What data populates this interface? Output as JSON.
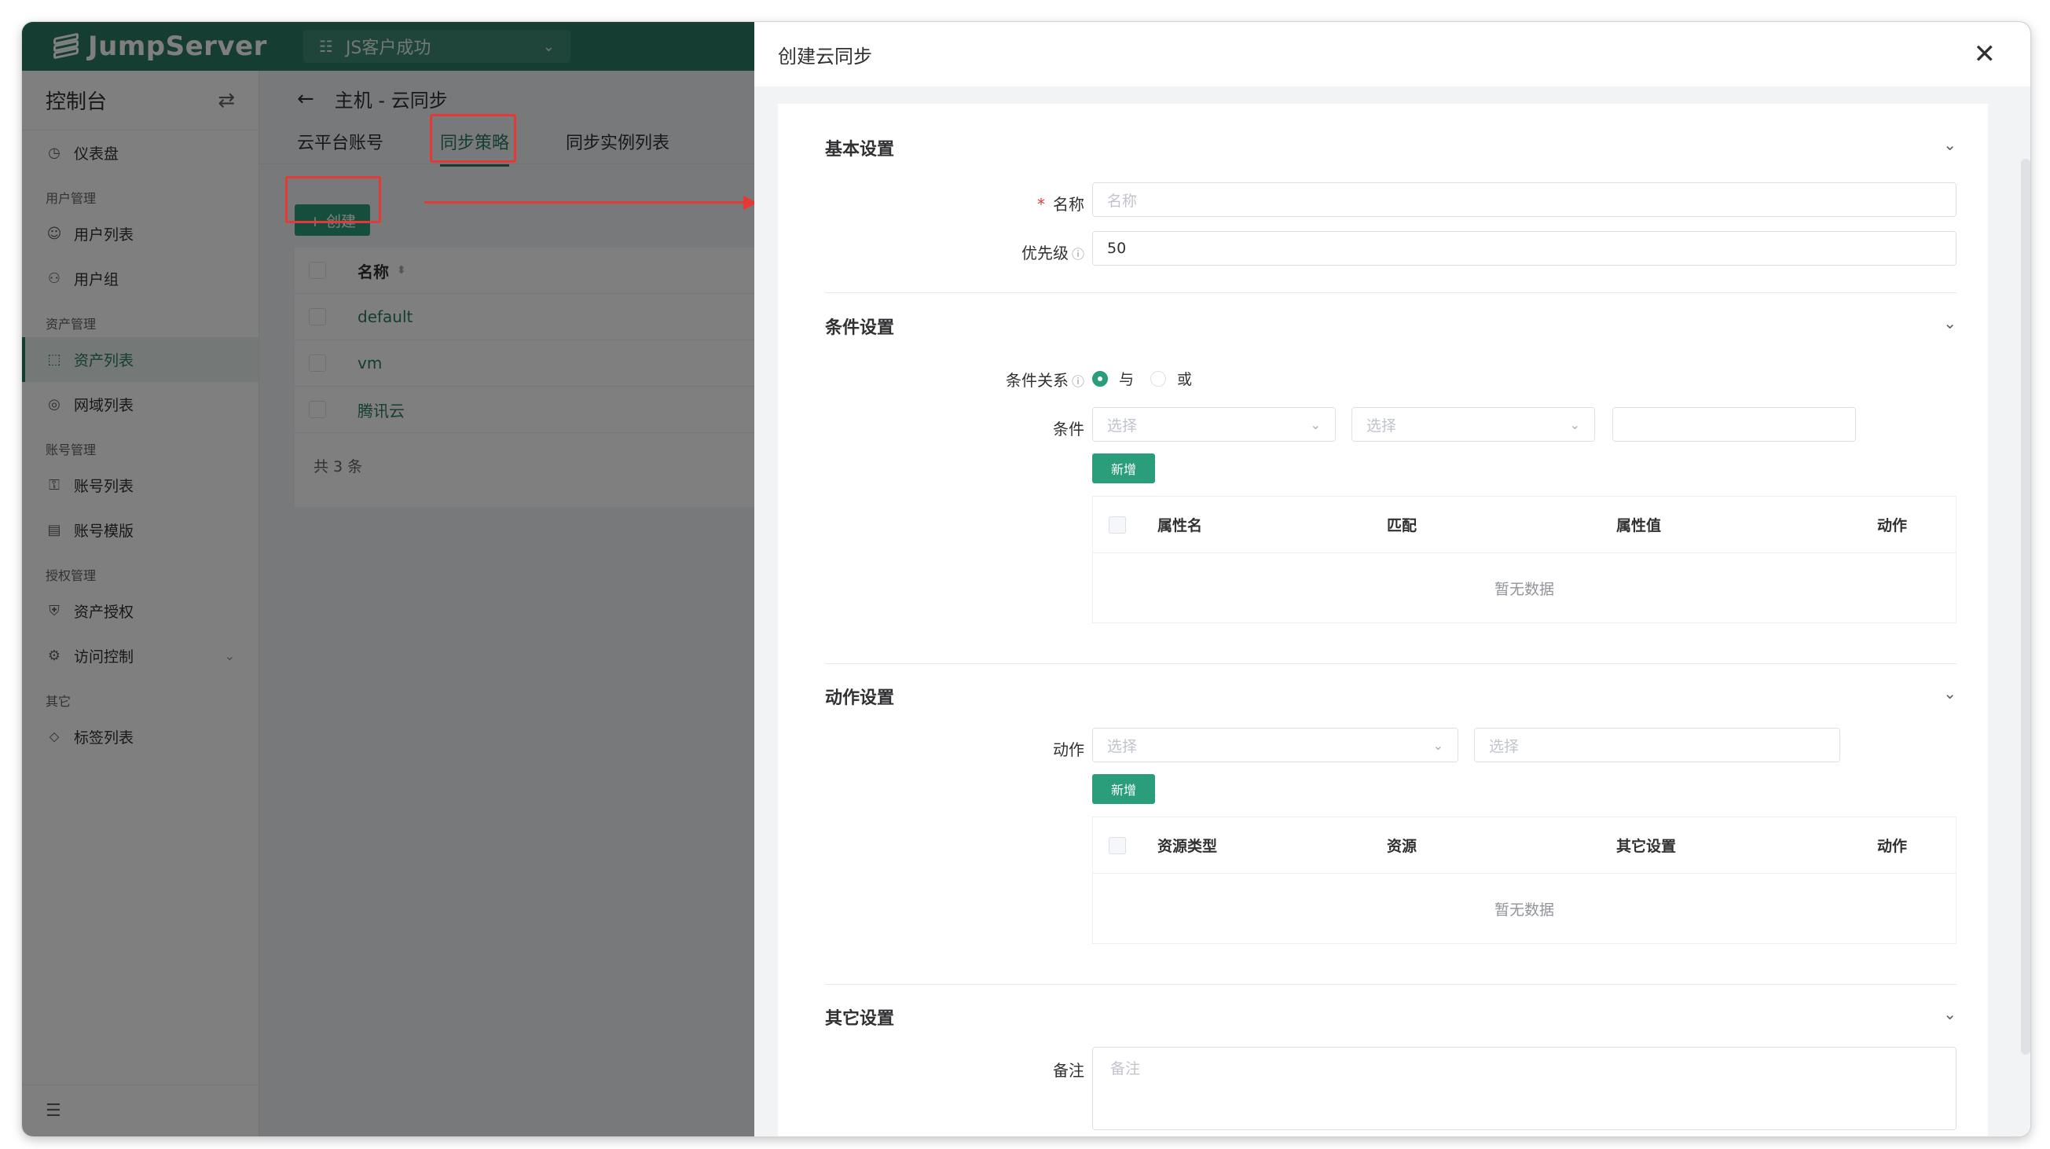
{
  "app": {
    "brand": "JumpServer",
    "org_selector": "JS客户成功"
  },
  "sidebar": {
    "title": "控制台",
    "items": [
      {
        "type": "item",
        "label": "仪表盘",
        "icon": "dashboard-icon",
        "active": false
      },
      {
        "type": "group",
        "label": "用户管理"
      },
      {
        "type": "item",
        "label": "用户列表",
        "icon": "user-icon",
        "active": false
      },
      {
        "type": "item",
        "label": "用户组",
        "icon": "user-group-icon",
        "active": false
      },
      {
        "type": "group",
        "label": "资产管理"
      },
      {
        "type": "item",
        "label": "资产列表",
        "icon": "asset-icon",
        "active": true
      },
      {
        "type": "item",
        "label": "网域列表",
        "icon": "domain-icon",
        "active": false
      },
      {
        "type": "group",
        "label": "账号管理"
      },
      {
        "type": "item",
        "label": "账号列表",
        "icon": "lock-icon",
        "active": false
      },
      {
        "type": "item",
        "label": "账号模版",
        "icon": "template-icon",
        "active": false
      },
      {
        "type": "group",
        "label": "授权管理"
      },
      {
        "type": "item",
        "label": "资产授权",
        "icon": "shield-icon",
        "active": false
      },
      {
        "type": "item",
        "label": "访问控制",
        "icon": "access-control-icon",
        "active": false,
        "expandable": true
      },
      {
        "type": "group",
        "label": "其它"
      },
      {
        "type": "item",
        "label": "标签列表",
        "icon": "tag-icon",
        "active": false
      }
    ]
  },
  "page": {
    "breadcrumb": "主机 - 云同步",
    "tabs": [
      {
        "label": "云平台账号",
        "active": false
      },
      {
        "label": "同步策略",
        "active": true
      },
      {
        "label": "同步实例列表",
        "active": false
      }
    ],
    "create_button": "+ 创建",
    "table": {
      "header": "名称",
      "rows": [
        "default",
        "vm",
        "腾讯云"
      ],
      "total": "共 3 条"
    }
  },
  "drawer": {
    "title": "创建云同步",
    "sections": {
      "basic": {
        "title": "基本设置",
        "name_label": "名称",
        "name_placeholder": "名称",
        "priority_label": "优先级",
        "priority_value": "50"
      },
      "condition": {
        "title": "条件设置",
        "relation_label": "条件关系",
        "relation_options": [
          "与",
          "或"
        ],
        "relation_selected": "与",
        "condition_label": "条件",
        "select1_placeholder": "选择",
        "select2_placeholder": "选择",
        "add_button": "新增",
        "table_headers": [
          "属性名",
          "匹配",
          "属性值",
          "动作"
        ],
        "empty_text": "暂无数据"
      },
      "action": {
        "title": "动作设置",
        "action_label": "动作",
        "select1_placeholder": "选择",
        "select2_placeholder": "选择",
        "add_button": "新增",
        "table_headers": [
          "资源类型",
          "资源",
          "其它设置",
          "动作"
        ],
        "empty_text": "暂无数据"
      },
      "other": {
        "title": "其它设置",
        "comment_label": "备注",
        "comment_placeholder": "备注"
      }
    }
  },
  "colors": {
    "brand_green": "#2a7b64",
    "button_green": "#2a9d7a",
    "annotation_red": "#e53935"
  }
}
